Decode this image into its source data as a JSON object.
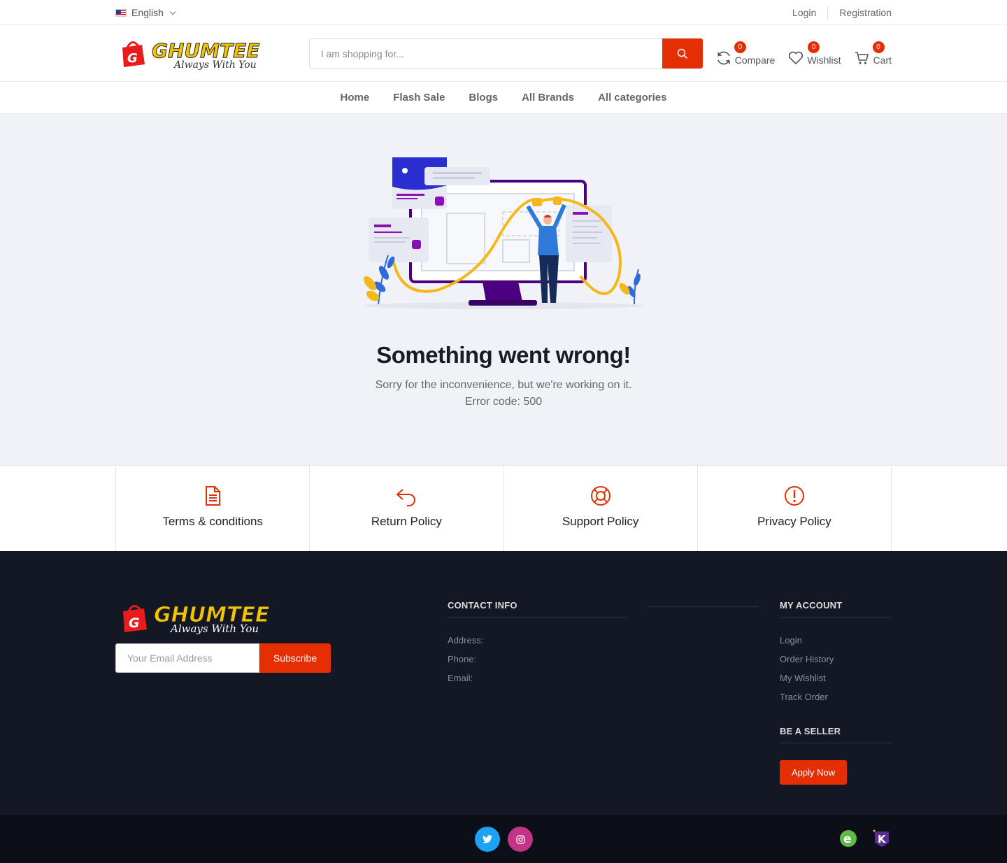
{
  "topbar": {
    "language": "English",
    "login": "Login",
    "registration": "Registration"
  },
  "header": {
    "logo": {
      "brand": "GHUMTEE",
      "tagline": "Always With You"
    },
    "search_placeholder": "I am shopping for...",
    "compare": {
      "label": "Compare",
      "count": "0"
    },
    "wishlist": {
      "label": "Wishlist",
      "count": "0"
    },
    "cart": {
      "label": "Cart",
      "count": "0"
    }
  },
  "nav": {
    "items": [
      {
        "label": "Home"
      },
      {
        "label": "Flash Sale"
      },
      {
        "label": "Blogs"
      },
      {
        "label": "All Brands"
      },
      {
        "label": "All categories"
      }
    ]
  },
  "error": {
    "title": "Something went wrong!",
    "message": "Sorry for the inconvenience, but we're working on it.",
    "code": "Error code: 500"
  },
  "policies": [
    {
      "label": "Terms & conditions",
      "icon": "document-icon"
    },
    {
      "label": "Return Policy",
      "icon": "return-arrow-icon"
    },
    {
      "label": "Support Policy",
      "icon": "lifebuoy-icon"
    },
    {
      "label": "Privacy Policy",
      "icon": "exclamation-icon"
    }
  ],
  "footer": {
    "email_placeholder": "Your Email Address",
    "subscribe": "Subscribe",
    "contact": {
      "title": "CONTACT INFO",
      "address": "Address:",
      "phone": "Phone:",
      "email": "Email:"
    },
    "account": {
      "title": "MY ACCOUNT",
      "links": [
        {
          "label": "Login"
        },
        {
          "label": "Order History"
        },
        {
          "label": "My Wishlist"
        },
        {
          "label": "Track Order"
        }
      ]
    },
    "seller": {
      "title": "BE A SELLER",
      "button": "Apply Now"
    }
  },
  "colors": {
    "accent": "#e62e04",
    "footer_bg": "#131824",
    "main_bg": "#f0f2f7",
    "twitter": "#1da1f2",
    "instagram": "#c13584"
  }
}
